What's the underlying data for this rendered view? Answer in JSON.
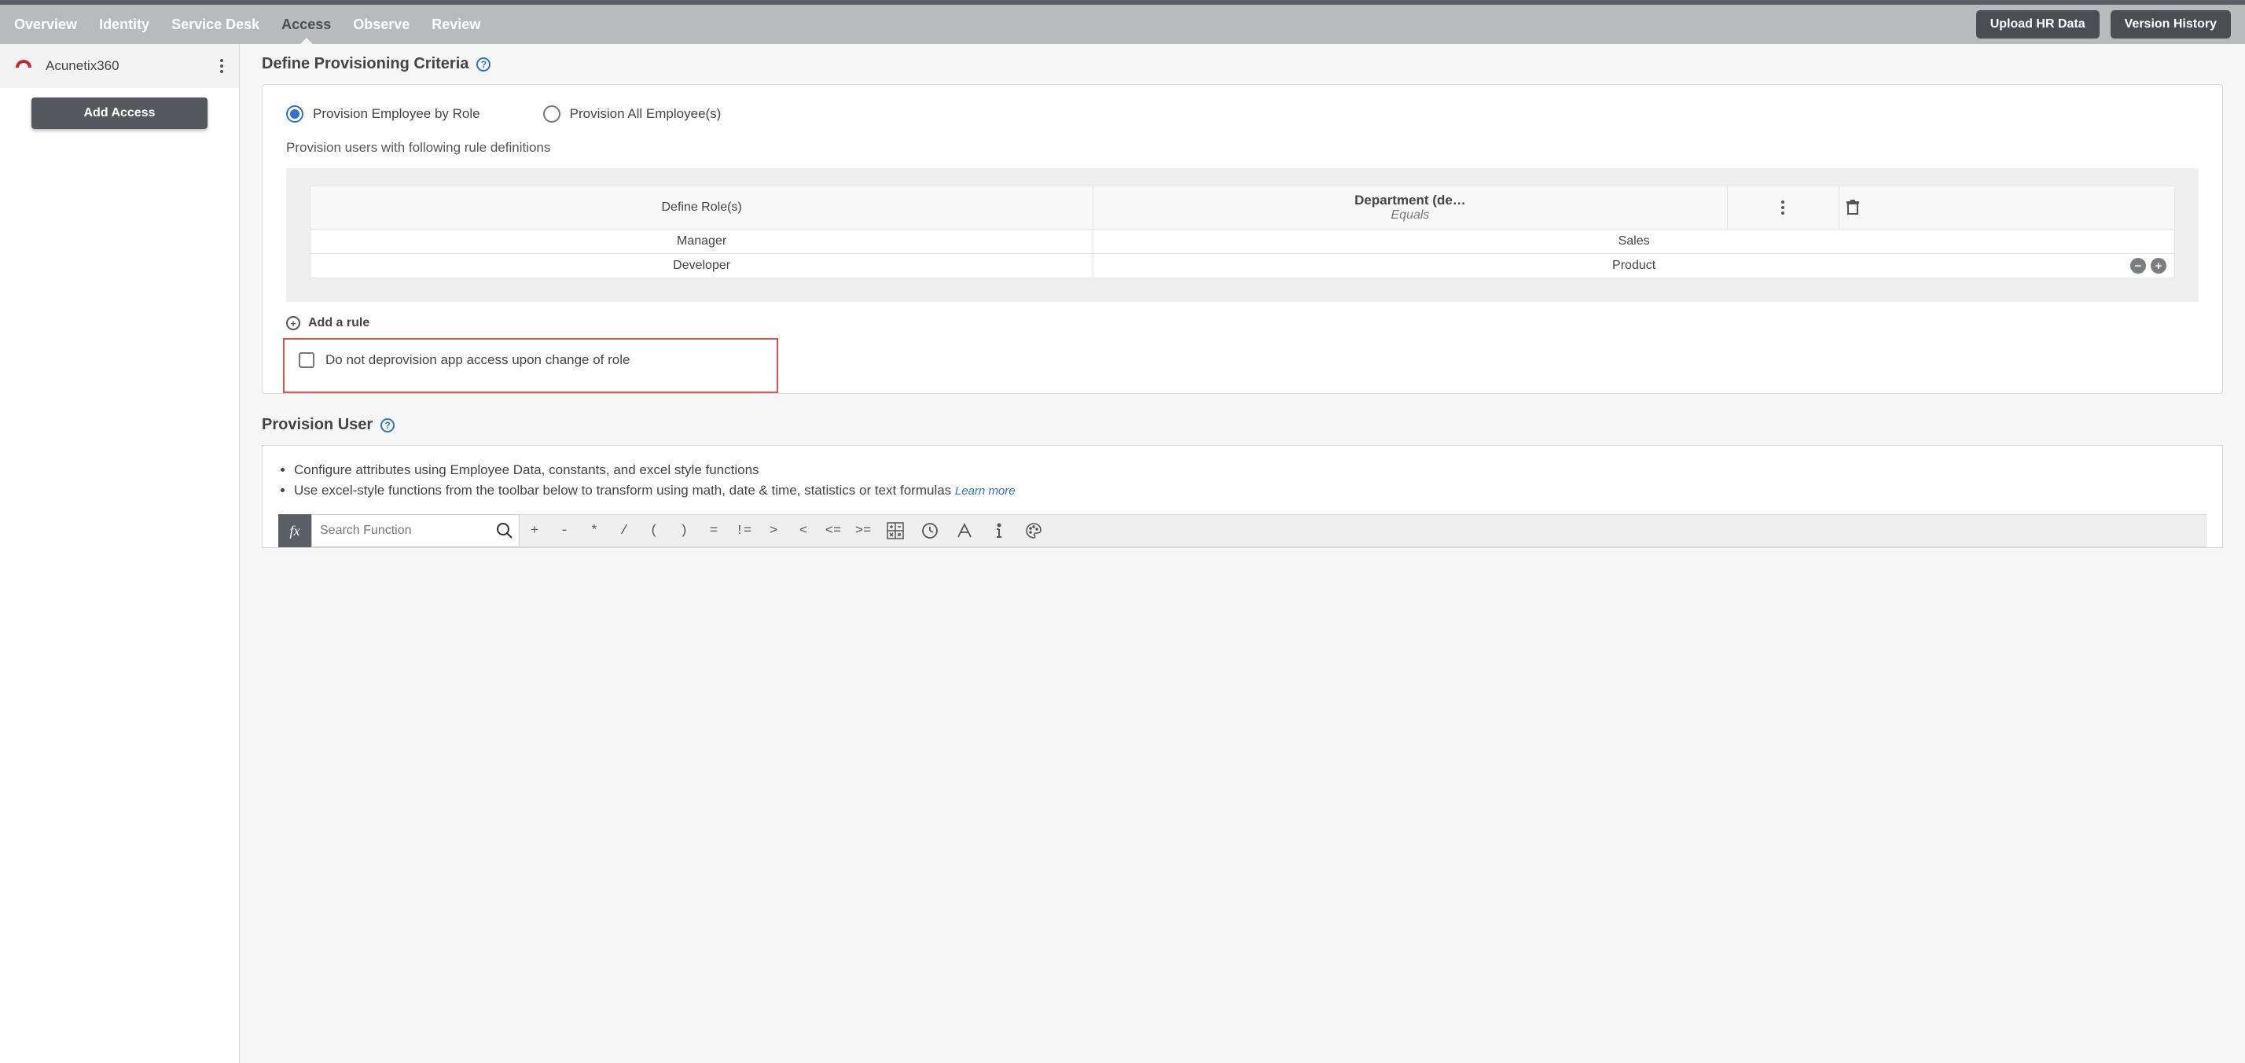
{
  "nav": {
    "items": [
      "Overview",
      "Identity",
      "Service Desk",
      "Access",
      "Observe",
      "Review"
    ],
    "active_index": 3,
    "buttons": {
      "upload": "Upload HR Data",
      "version": "Version History"
    }
  },
  "sidebar": {
    "app_name": "Acunetix360",
    "add_access": "Add Access"
  },
  "section1": {
    "title": "Define Provisioning Criteria",
    "radio1": "Provision Employee by Role",
    "radio2": "Provision All Employee(s)",
    "caption": "Provision users with following rule definitions",
    "col_role": "Define Role(s)",
    "col_cond_head": "Department (de…",
    "col_cond_sub": "Equals",
    "rows": [
      {
        "role": "Manager",
        "cond": "Sales"
      },
      {
        "role": "Developer",
        "cond": "Product"
      }
    ],
    "add_rule": "Add a rule",
    "checkbox_label": "Do not deprovision app access upon change of role"
  },
  "section2": {
    "title": "Provision User",
    "bullet1": "Configure attributes using Employee Data, constants, and excel style functions",
    "bullet2": "Use excel-style functions from the toolbar below to transform using math, date & time, statistics or text formulas ",
    "learn_more": "Learn more",
    "fx": "fx",
    "search_placeholder": "Search Function",
    "ops": [
      "+",
      "-",
      "*",
      "/",
      "(",
      ")",
      "=",
      "!=",
      ">",
      "<",
      "<=",
      ">="
    ]
  }
}
